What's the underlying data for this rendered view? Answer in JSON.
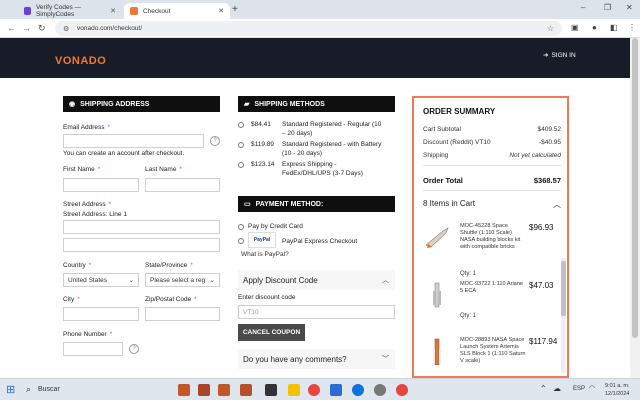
{
  "browser": {
    "tabs": [
      {
        "title": "Verify Codes — SimplyCodes",
        "active": false,
        "favicon_color": "#6b3fd4"
      },
      {
        "title": "Checkout",
        "active": true,
        "favicon_color": "#f2792f"
      }
    ],
    "new_tab": "+",
    "url": "vonado.com/checkout/",
    "window_controls": {
      "minimize": "–",
      "maximize": "❐",
      "close": "✕"
    }
  },
  "site": {
    "logo": "VONADO",
    "sign_in": "SIGN IN"
  },
  "shipping_address": {
    "title": "SHIPPING ADDRESS",
    "email_label": "Email Address",
    "email_required": "*",
    "email_value": "",
    "account_note": "You can create an account after checkout.",
    "first_name_label": "First Name",
    "last_name_label": "Last Name",
    "street_label": "Street Address",
    "street_line1_label": "Street Address: Line 1",
    "country_label": "Country",
    "country_value": "United States",
    "state_label": "State/Province",
    "state_placeholder": "Please select a reg",
    "city_label": "City",
    "zip_label": "Zip/Postal Code",
    "phone_label": "Phone Number",
    "required": "*",
    "help": "?"
  },
  "shipping_methods": {
    "title": "SHIPPING METHODS",
    "options": [
      {
        "price": "$84.41",
        "name": "Standard Registered - Regular (10 – 20 days)"
      },
      {
        "price": "$119.89",
        "name": "Standard Registered - with Battery (10 - 20 days)"
      },
      {
        "price": "$123.14",
        "name": "Express Shipping - FedEx/DHL/UPS (3-7 Days)"
      }
    ]
  },
  "payment": {
    "title": "PAYMENT METHOD:",
    "credit_card": "Pay by Credit Card",
    "paypal_logo": "PayPal",
    "paypal_express": "PayPal Express Checkout",
    "what_is_paypal": "What is PayPal?"
  },
  "discount": {
    "title": "Apply Discount Code",
    "enter_label": "Enter discount code",
    "code_value": "VT10",
    "cancel_button": "CANCEL COUPON"
  },
  "comments": {
    "title": "Do you have any comments?"
  },
  "order_summary": {
    "title": "ORDER SUMMARY",
    "rows": [
      {
        "label": "Cart Subtotal",
        "value": "$409.52"
      },
      {
        "label": "Discount (Reddit) VT10",
        "value": "-$40.95"
      },
      {
        "label": "Shipping",
        "value": "Not yet calculated"
      }
    ],
    "total_label": "Order Total",
    "total_value": "$368.57",
    "items_label": "8 Items in Cart",
    "items": [
      {
        "name": "MOC-45228 Space Shuttle (1:110 Scale) NASA building blocks kit with compatible bricks",
        "price": "$96.93",
        "qty": "Qty: 1"
      },
      {
        "name": "MOC-93722 1:110 Ariane 5 ECA",
        "price": "$47.03",
        "qty": "Qty: 1"
      },
      {
        "name": "MOC-28893 NASA Space Launch System Artemis SLS Block 1 (1:110 Saturn V scale)",
        "price": "$117.94",
        "qty": ""
      }
    ]
  },
  "taskbar": {
    "search": "Buscar",
    "lang": "ESP",
    "time": "9:01 a. m.",
    "date": "12/1/2024"
  }
}
